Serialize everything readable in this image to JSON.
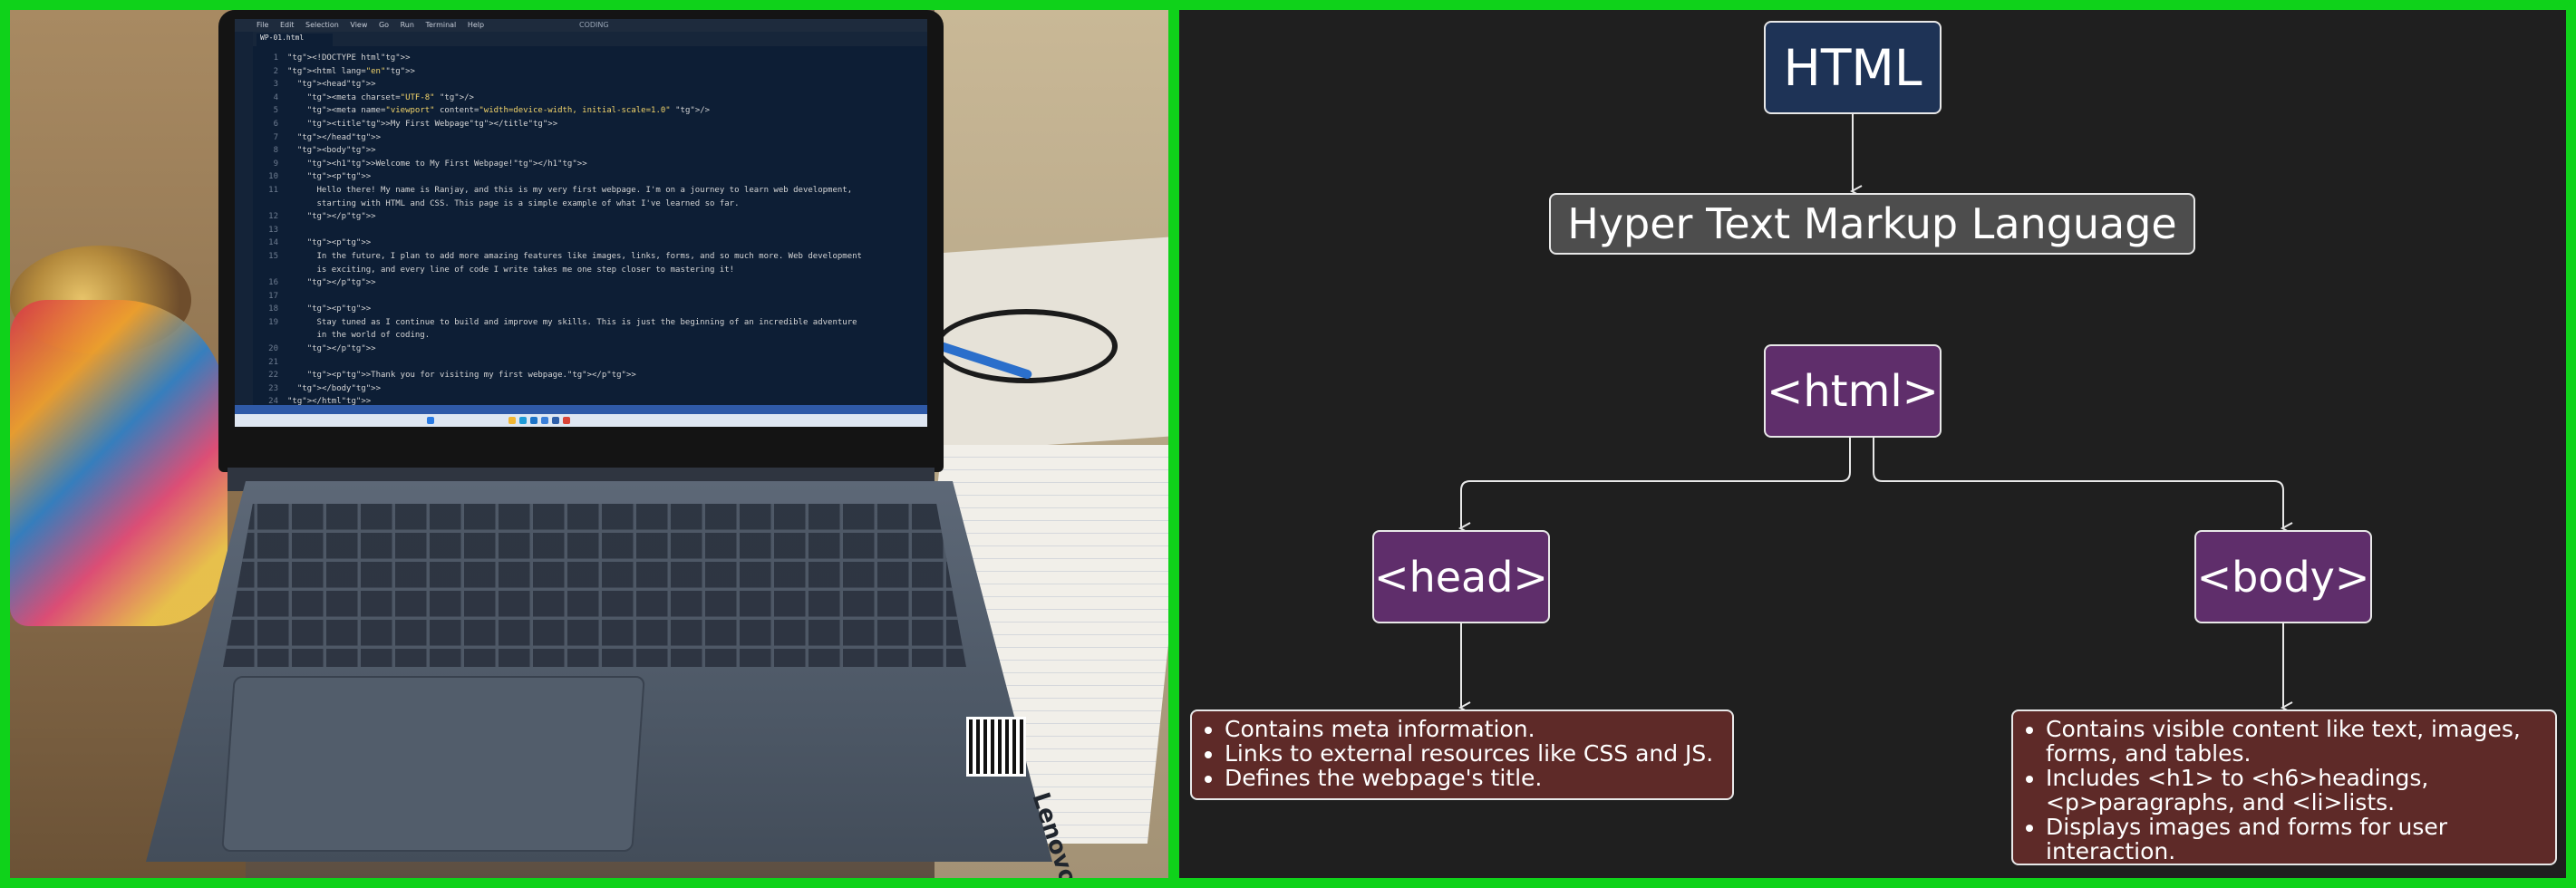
{
  "photo": {
    "editor_menu": [
      "File",
      "Edit",
      "Selection",
      "View",
      "Go",
      "Run",
      "Terminal",
      "Help"
    ],
    "editor_search": "CODING",
    "editor_tab": "WP-01.html",
    "brand": "Lenovo",
    "code_lines": [
      "<!DOCTYPE html>",
      "<html lang=\"en\">",
      "  <head>",
      "    <meta charset=\"UTF-8\" />",
      "    <meta name=\"viewport\" content=\"width=device-width, initial-scale=1.0\" />",
      "    <title>My First Webpage</title>",
      "  </head>",
      "  <body>",
      "    <h1>Welcome to My First Webpage!</h1>",
      "    <p>",
      "      Hello there! My name is Ranjay, and this is my very first webpage. I'm on a journey to learn web development,",
      "      starting with HTML and CSS. This page is a simple example of what I've learned so far.",
      "    </p>",
      "",
      "    <p>",
      "      In the future, I plan to add more amazing features like images, links, forms, and so much more. Web development",
      "      is exciting, and every line of code I write takes me one step closer to mastering it!",
      "    </p>",
      "",
      "    <p>",
      "      Stay tuned as I continue to build and improve my skills. This is just the beginning of an incredible adventure",
      "      in the world of coding.",
      "    </p>",
      "",
      "    <p>Thank you for visiting my first webpage.</p>",
      "  </body>",
      "</html>"
    ],
    "line_numbers": [
      "1",
      "2",
      "3",
      "4",
      "5",
      "6",
      "7",
      "8",
      "9",
      "10",
      "11",
      "",
      "12",
      "13",
      "14",
      "15",
      "",
      "16",
      "17",
      "18",
      "19",
      "",
      "20",
      "21",
      "22",
      "23",
      "24"
    ]
  },
  "diagram": {
    "root": "HTML",
    "expansion": "Hyper Text Markup Language",
    "html_tag": "<html>",
    "head_tag": "<head>",
    "body_tag": "<body>",
    "head_items": [
      "Contains meta information.",
      "Links to external resources like CSS and JS.",
      "Defines the webpage's title."
    ],
    "body_items": [
      "Contains visible content like text, images, forms, and tables.",
      "Includes <h1> to <h6>headings, <p>paragraphs, and <li>lists.",
      "Displays images and forms for user interaction."
    ],
    "colors": {
      "background": "#1f1f1f",
      "root_fill": "#1e3356",
      "expansion_fill": "#4d4d4d",
      "tag_fill": "#5f2e6b",
      "description_fill": "#5e2a28",
      "frame": "#0fd21a"
    }
  }
}
